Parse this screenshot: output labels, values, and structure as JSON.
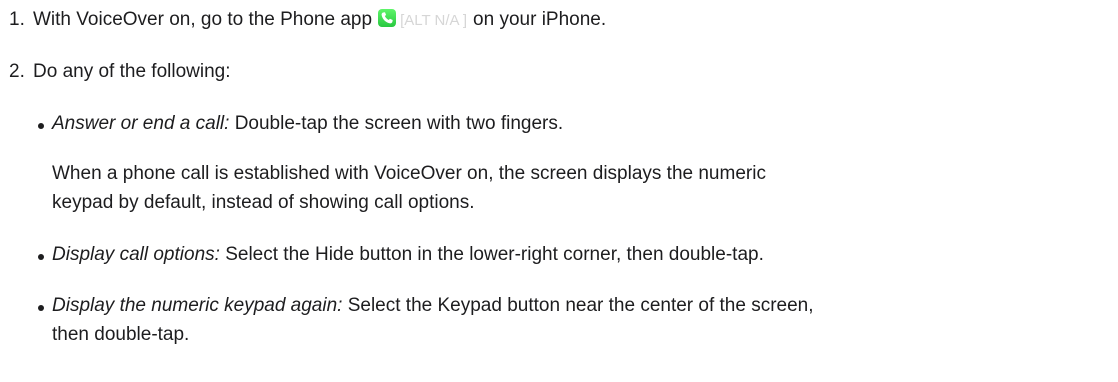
{
  "steps": [
    {
      "number": "1.",
      "text_before": "With VoiceOver on, go to the Phone app",
      "icon": "phone-app-icon",
      "alt_text": "[ALT N/A ]",
      "text_after": "on your iPhone."
    },
    {
      "number": "2.",
      "text": "Do any of the following:"
    }
  ],
  "bullets": [
    {
      "label": "Answer or end a call:",
      "text": " Double-tap the screen with two fingers.",
      "note_line1": "When a phone call is established with VoiceOver on, the screen displays the numeric",
      "note_line2": "keypad by default, instead of showing call options."
    },
    {
      "label": "Display call options:",
      "text": " Select the Hide button in the lower-right corner, then double-tap."
    },
    {
      "label": "Display the numeric keypad again:",
      "text": " Select the Keypad button near the center of the screen,",
      "text_line2": "then double-tap."
    }
  ],
  "colors": {
    "text": "#1d1d1f",
    "phone_icon": "#34c759",
    "alt_text": "#d6d6d6"
  }
}
